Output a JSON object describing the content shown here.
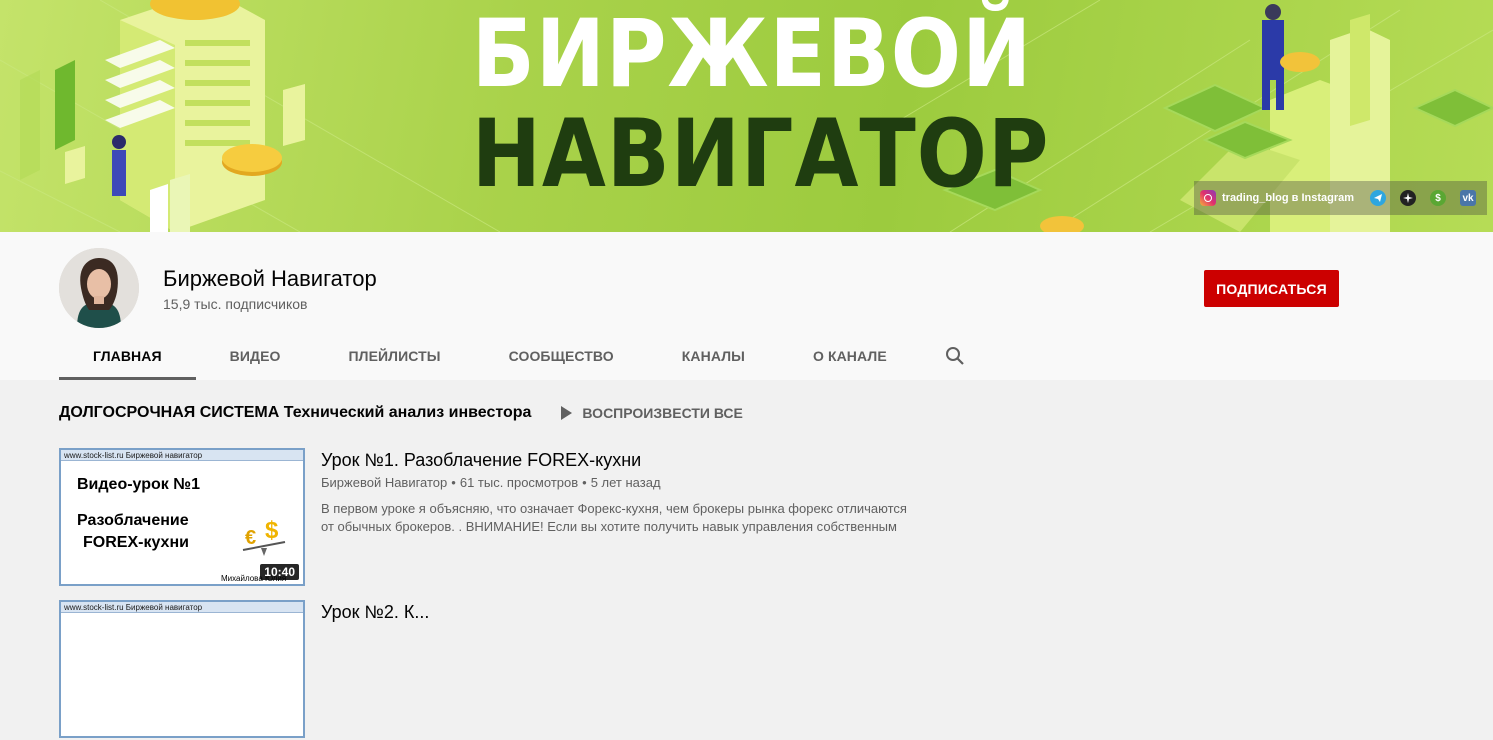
{
  "banner": {
    "title_line1": "БИРЖЕВОЙ",
    "title_line2": "НАВИГАТОР",
    "links": [
      {
        "label": "trading_blog в Instagram",
        "icon": "instagram-icon"
      },
      {
        "label": "",
        "icon": "telegram-icon"
      },
      {
        "label": "",
        "icon": "zen-icon"
      },
      {
        "label": "",
        "icon": "money-icon"
      },
      {
        "label": "",
        "icon": "vk-icon"
      }
    ]
  },
  "channel": {
    "name": "Биржевой Навигатор",
    "subscribers": "15,9 тыс. подписчиков",
    "subscribe_label": "ПОДПИСАТЬСЯ",
    "subscribe_color": "#cc0000"
  },
  "tabs": [
    {
      "label": "ГЛАВНАЯ",
      "active": true
    },
    {
      "label": "ВИДЕО",
      "active": false
    },
    {
      "label": "ПЛЕЙЛИСТЫ",
      "active": false
    },
    {
      "label": "СООБЩЕСТВО",
      "active": false
    },
    {
      "label": "КАНАЛЫ",
      "active": false
    },
    {
      "label": "О КАНАЛЕ",
      "active": false
    }
  ],
  "section": {
    "title": "ДОЛГОСРОЧНАЯ СИСТЕМА Технический анализ инвестора",
    "play_all": "ВОСПРОИЗВЕСТИ ВСЕ"
  },
  "videos": [
    {
      "thumb_header": "www.stock-list.ru   Биржевой навигатор",
      "thumb_line1": "Видео-урок №1",
      "thumb_line2": "Разоблачение",
      "thumb_line3": "FOREX-кухни",
      "thumb_author": "Михайлова Юлия",
      "duration": "10:40",
      "title": "Урок №1. Разоблачение FOREX-кухни",
      "channel": "Биржевой Навигатор",
      "views": "61 тыс. просмотров",
      "age": "5 лет назад",
      "description": "В первом уроке я объясняю, что означает Форекс-кухня, чем брокеры рынка форекс отличаются от обычных брокеров. . ВНИМАНИЕ! Если вы хотите получить навык управления собственным"
    },
    {
      "thumb_header": "www.stock-list.ru   Биржевой навигатор",
      "title": "Урок №2. К..."
    }
  ]
}
